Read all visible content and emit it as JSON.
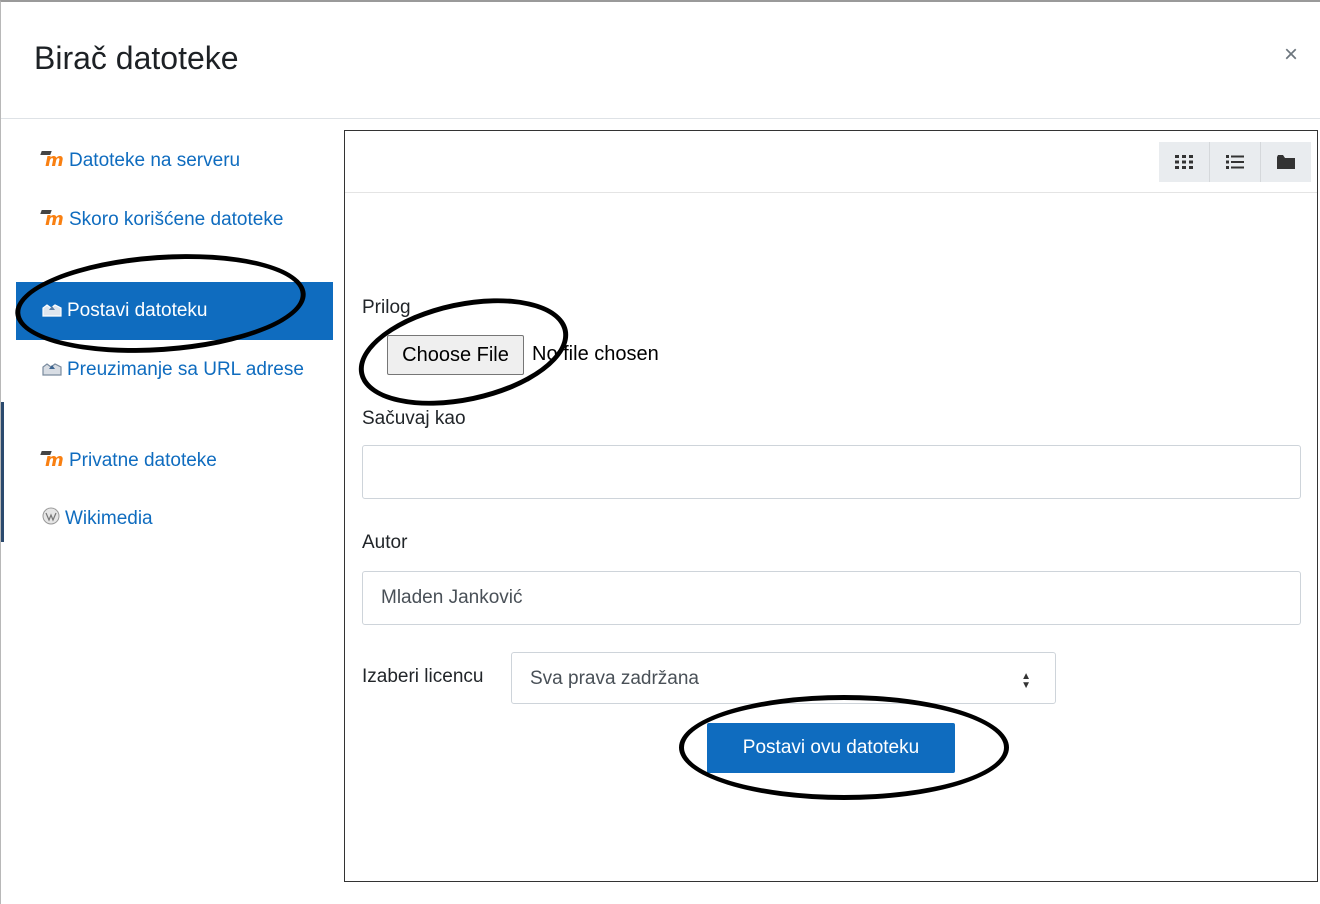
{
  "dialog": {
    "title": "Birač datoteke",
    "close_symbol": "×"
  },
  "sidebar": {
    "items": [
      {
        "label": "Datoteke na serveru",
        "icon": "moodle-icon",
        "active": false
      },
      {
        "label": "Skoro korišćene datoteke",
        "icon": "moodle-icon",
        "active": false
      },
      {
        "label": "Postavi datoteku",
        "icon": "upload-icon",
        "active": true
      },
      {
        "label": "Preuzimanje sa URL adrese",
        "icon": "upload-icon",
        "active": false
      },
      {
        "label": "Privatne datoteke",
        "icon": "moodle-icon",
        "active": false
      },
      {
        "label": "Wikimedia",
        "icon": "wikimedia-icon",
        "active": false
      }
    ]
  },
  "toolbar": {
    "views": [
      "grid-view-icon",
      "list-view-icon",
      "folder-view-icon"
    ]
  },
  "form": {
    "attachment_label": "Prilog",
    "choose_file_label": "Choose File",
    "file_status": "No file chosen",
    "save_as_label": "Sačuvaj kao",
    "save_as_value": "",
    "author_label": "Autor",
    "author_value": "Mladen Janković",
    "license_label": "Izaberi licencu",
    "license_value": "Sva prava zadržana",
    "submit_label": "Postavi ovu datoteku"
  },
  "colors": {
    "accent": "#0f6cbf",
    "moodle_orange": "#f98012"
  }
}
